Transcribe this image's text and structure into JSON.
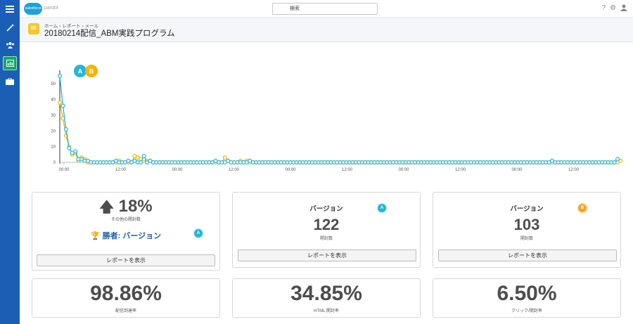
{
  "app": {
    "logo_text": "salesforce",
    "product": "pardot",
    "search_placeholder": "検索"
  },
  "nav": [
    {
      "icon": "menu-icon"
    },
    {
      "icon": "wand-icon"
    },
    {
      "icon": "users-icon"
    },
    {
      "icon": "reports-icon",
      "active": true
    },
    {
      "icon": "briefcase-icon"
    }
  ],
  "topbar_icons": [
    "help-icon",
    "settings-icon",
    "user-icon"
  ],
  "breadcrumb": [
    "ホーム",
    "レポート",
    "メール"
  ],
  "page_title": "20180214配信_ABM実践プログラム",
  "chart_data": {
    "type": "line",
    "series_markers": [
      "A",
      "B"
    ],
    "y_ticks": [
      "50",
      "40",
      "30",
      "20",
      "10",
      "0"
    ],
    "x_tick_labels": [
      "00:00",
      "12:00",
      "00:00",
      "12:00",
      "00:00",
      "12:00",
      "00:00",
      "12:00",
      "00:00",
      "12:00"
    ],
    "ylim": [
      0,
      55
    ],
    "series": [
      {
        "values": [
          55,
          36,
          21,
          9,
          6,
          7,
          2,
          2,
          1,
          1,
          0,
          0,
          0,
          0,
          0,
          0,
          0,
          0,
          1,
          0,
          0,
          0,
          1,
          0,
          1,
          0,
          0,
          4,
          0,
          1,
          0,
          0,
          0,
          0,
          0,
          0,
          0,
          0,
          0,
          0,
          0,
          0,
          0,
          0,
          0,
          0,
          0,
          0,
          0,
          0,
          1,
          0,
          0,
          0,
          1,
          0,
          0,
          0,
          0,
          0,
          0,
          1,
          0,
          0,
          0,
          0,
          0,
          0,
          0,
          0,
          0,
          0,
          0,
          0,
          0,
          0,
          0,
          0,
          0,
          0,
          0,
          0,
          0,
          0,
          0,
          0,
          0,
          0,
          0,
          0,
          0,
          0,
          0,
          0,
          0,
          0,
          0,
          0,
          0,
          0,
          0,
          0,
          0,
          0,
          0,
          0,
          0,
          0,
          0,
          0,
          0,
          0,
          0,
          0,
          0,
          0,
          0,
          0,
          0,
          0,
          0,
          0,
          0,
          0,
          0,
          0,
          0,
          0,
          0,
          0,
          0,
          0,
          0,
          0,
          0,
          0,
          0,
          0,
          0,
          0,
          0,
          0,
          0,
          0,
          0,
          0,
          0,
          0,
          0,
          0,
          0,
          0,
          0,
          0,
          0,
          0,
          0,
          0,
          1,
          0,
          0,
          0,
          0,
          0,
          0,
          0,
          0,
          0,
          0,
          0,
          0,
          0,
          0,
          0,
          0,
          0,
          0,
          0,
          0,
          2
        ],
        "color": "#26b5d8"
      },
      {
        "values": [
          38,
          28,
          17,
          10,
          5,
          6,
          1,
          3,
          2,
          0,
          0,
          0,
          0,
          0,
          0,
          0,
          0,
          0,
          0,
          1,
          0,
          0,
          0,
          0,
          4,
          3,
          2,
          2,
          1,
          1,
          0,
          0,
          0,
          0,
          0,
          0,
          0,
          0,
          0,
          0,
          0,
          0,
          0,
          0,
          0,
          0,
          0,
          0,
          0,
          0,
          0,
          0,
          0,
          3,
          1,
          0,
          0,
          0,
          1,
          0,
          1,
          0,
          0,
          0,
          0,
          0,
          0,
          0,
          0,
          0,
          0,
          0,
          0,
          0,
          0,
          0,
          0,
          0,
          0,
          0,
          0,
          0,
          0,
          0,
          0,
          0,
          0,
          0,
          0,
          0,
          0,
          0,
          0,
          0,
          0,
          0,
          0,
          0,
          0,
          0,
          0,
          0,
          0,
          0,
          0,
          0,
          0,
          0,
          0,
          0,
          0,
          0,
          0,
          0,
          0,
          0,
          0,
          0,
          0,
          0,
          0,
          0,
          0,
          0,
          0,
          0,
          0,
          0,
          0,
          0,
          0,
          0,
          0,
          0,
          0,
          0,
          0,
          0,
          0,
          0,
          0,
          0,
          0,
          0,
          0,
          0,
          0,
          0,
          0,
          0,
          0,
          0,
          0,
          0,
          0,
          0,
          0,
          0,
          0,
          0,
          0,
          0,
          0,
          0,
          0,
          0,
          0,
          0,
          0,
          0,
          0,
          0,
          0,
          0,
          0,
          0,
          0,
          0,
          0,
          0,
          1
        ],
        "color": "#f5b400"
      }
    ]
  },
  "cards": {
    "winner": {
      "delta": "18%",
      "delta_sub": "その他の開封数",
      "winner_label": "勝者: バージョン",
      "winner_badge": "A",
      "button": "レポートを表示"
    },
    "version_a": {
      "label": "バージョン",
      "badge": "A",
      "value": "122",
      "sub": "開封数",
      "button": "レポートを表示"
    },
    "version_b": {
      "label": "バージョン",
      "badge": "B",
      "value": "103",
      "sub": "開封数",
      "button": "レポートを表示"
    },
    "delivery": {
      "value": "98.86%",
      "sub": "配信到達率"
    },
    "html_open": {
      "value": "34.85%",
      "sub": "HTML 開封率"
    },
    "click_open": {
      "value": "6.50%",
      "sub": "クリック/開封率"
    }
  },
  "colors": {
    "nav": "#1b5fb4",
    "accent_a": "#26b5d8",
    "accent_b": "#f5b400",
    "winner": "#1f5fa8",
    "trophy": "#2a9d3a"
  }
}
